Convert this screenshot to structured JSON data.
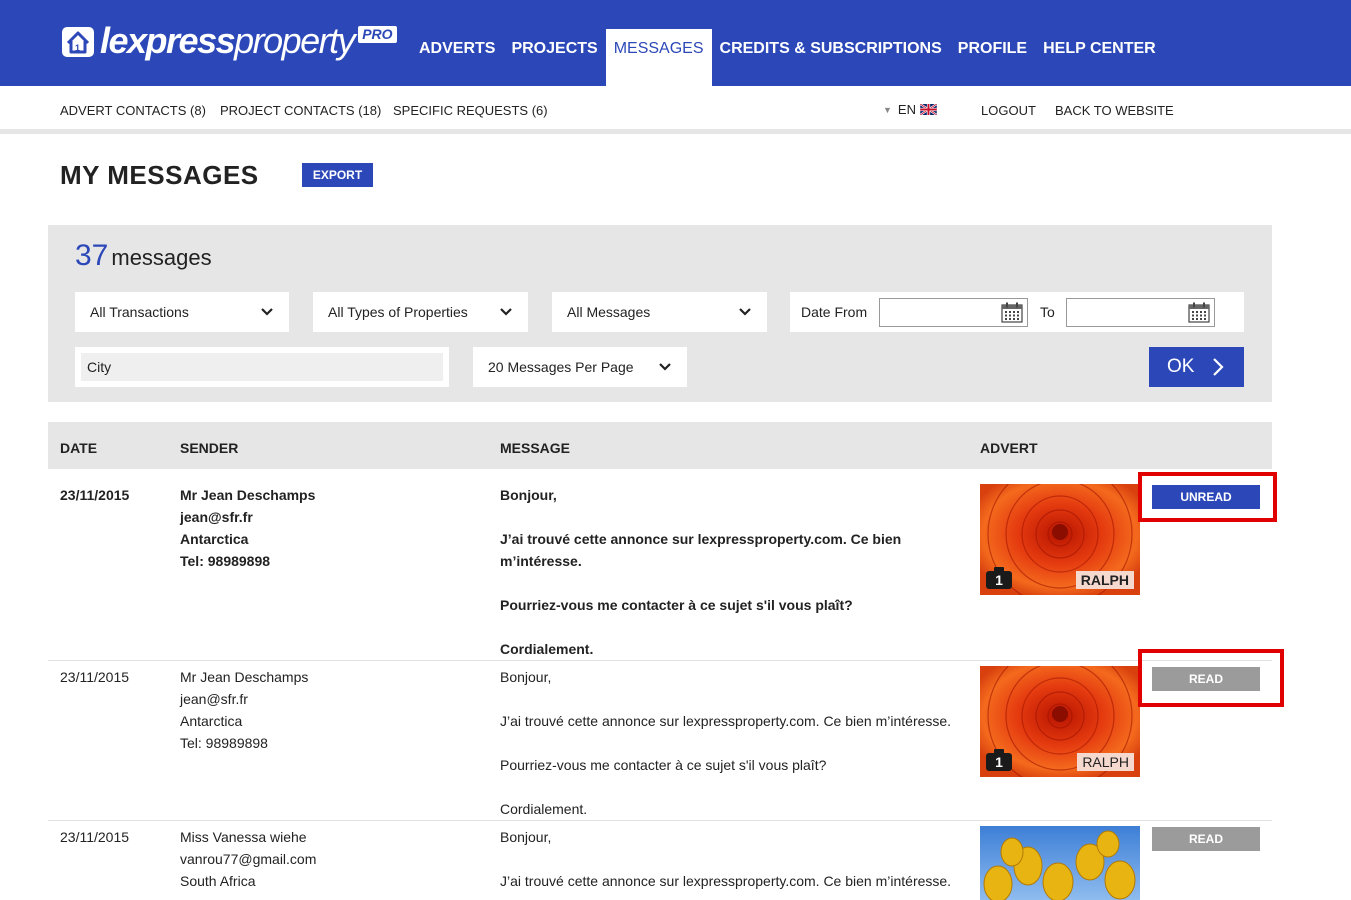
{
  "brand": {
    "name_bold": "lexpress",
    "name_light": "property",
    "badge": "PRO"
  },
  "main_nav": [
    {
      "label": "ADVERTS"
    },
    {
      "label": "PROJECTS"
    },
    {
      "label": "MESSAGES"
    },
    {
      "label": "CREDITS & SUBSCRIPTIONS"
    },
    {
      "label": "PROFILE"
    },
    {
      "label": "HELP CENTER"
    }
  ],
  "sub_nav": {
    "advert_contacts": "ADVERT CONTACTS (8)",
    "project_contacts": "PROJECT CONTACTS (18)",
    "specific_requests": "SPECIFIC REQUESTS (6)",
    "language": "EN",
    "logout": "LOGOUT",
    "back": "BACK TO WEBSITE"
  },
  "page": {
    "title": "MY MESSAGES",
    "export_label": "EXPORT"
  },
  "filters": {
    "count": "37",
    "count_label": "messages",
    "transactions": "All Transactions",
    "property_types": "All Types of Properties",
    "messages": "All Messages",
    "date_from_label": "Date From",
    "date_to_label": "To",
    "date_from_value": "",
    "date_to_value": "",
    "city_placeholder": "City",
    "per_page": "20 Messages Per Page",
    "ok_label": "OK"
  },
  "table": {
    "headers": {
      "date": "DATE",
      "sender": "SENDER",
      "message": "MESSAGE",
      "advert": "ADVERT"
    },
    "rows": [
      {
        "date": "23/11/2015",
        "sender_name": "Mr Jean Deschamps",
        "sender_email": "jean@sfr.fr",
        "sender_country": "Antarctica",
        "sender_phone": "Tel: 98989898",
        "msg_1": "Bonjour,",
        "msg_2": "J’ai trouvé cette annonce sur lexpressproperty.com. Ce bien",
        "msg_2b": "m’intéresse.",
        "msg_3": "Pourriez-vous me contacter à ce sujet s'il vous plaît?",
        "msg_4": "Cordialement.",
        "photo_count": "1",
        "agent": "RALPH",
        "status": "UNREAD"
      },
      {
        "date": "23/11/2015",
        "sender_name": "Mr Jean Deschamps",
        "sender_email": "jean@sfr.fr",
        "sender_country": "Antarctica",
        "sender_phone": "Tel: 98989898",
        "msg_1": "Bonjour,",
        "msg_2": "J’ai trouvé cette annonce sur lexpressproperty.com. Ce bien m’intéresse.",
        "msg_3": "Pourriez-vous me contacter à ce sujet s'il vous plaît?",
        "msg_4": "Cordialement.",
        "photo_count": "1",
        "agent": "RALPH",
        "status": "READ"
      },
      {
        "date": "23/11/2015",
        "sender_name": "Miss Vanessa wiehe",
        "sender_email": "vanrou77@gmail.com",
        "sender_country": "South Africa",
        "msg_1": "Bonjour,",
        "msg_2": "J’ai trouvé cette annonce sur lexpressproperty.com. Ce bien m’intéresse.",
        "status": "READ"
      }
    ]
  },
  "colors": {
    "brand_blue": "#2c48b8",
    "panel_grey": "#e6e6e6",
    "read_grey": "#9b9b9b",
    "highlight_red": "#e00000"
  }
}
